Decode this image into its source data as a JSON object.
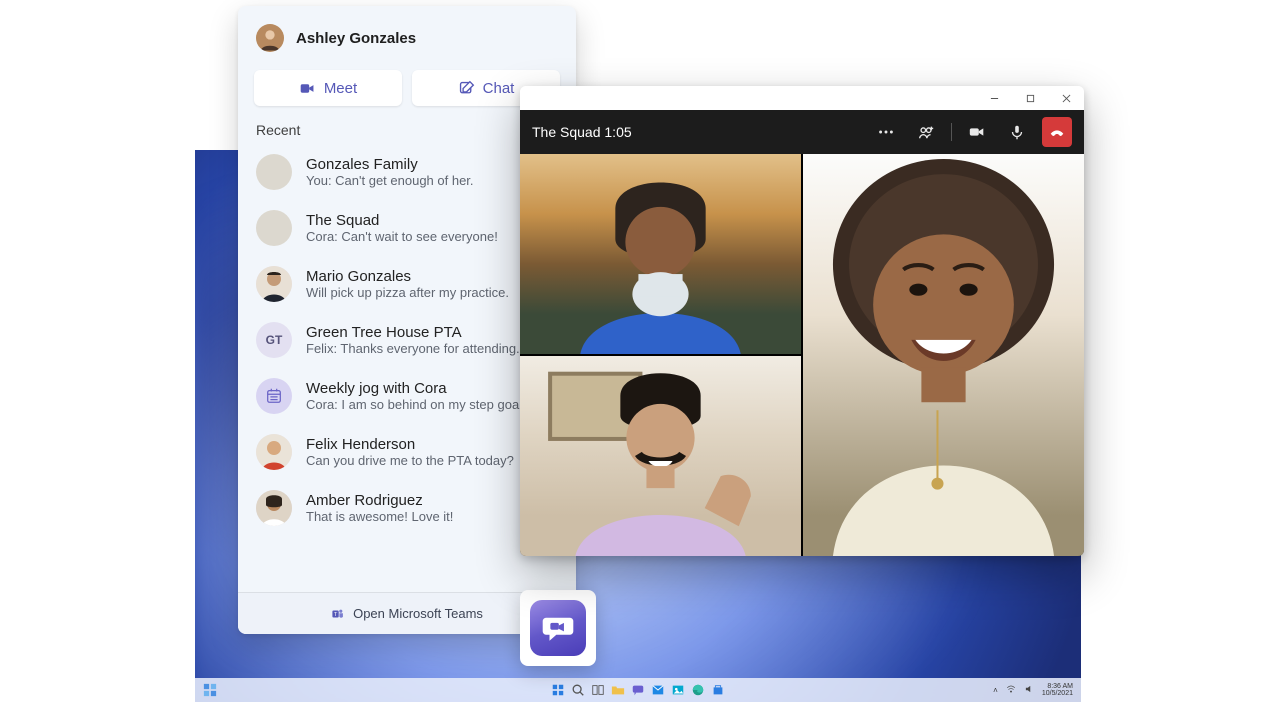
{
  "colors": {
    "accent": "#5558b7",
    "hangup": "#d53a3a"
  },
  "panel": {
    "user_name": "Ashley Gonzales",
    "actions": {
      "meet": "Meet",
      "chat": "Chat"
    },
    "section_label": "Recent",
    "footer": "Open Microsoft Teams",
    "chats": [
      {
        "title": "Gonzales Family",
        "preview": "You: Can't get enough of her.",
        "avatar": "grid"
      },
      {
        "title": "The Squad",
        "preview": "Cora: Can't wait to see everyone!",
        "avatar": "grid"
      },
      {
        "title": "Mario Gonzales",
        "preview": "Will pick up pizza after my practice.",
        "avatar": "person"
      },
      {
        "title": "Green Tree House PTA",
        "preview": "Felix: Thanks everyone for attending.",
        "avatar": "initials",
        "initials": "GT"
      },
      {
        "title": "Weekly jog with Cora",
        "preview": "Cora: I am so behind on my step goals.",
        "avatar": "calendar"
      },
      {
        "title": "Felix Henderson",
        "preview": "Can you drive me to the PTA today?",
        "avatar": "person"
      },
      {
        "title": "Amber Rodriguez",
        "preview": "That is awesome! Love it!",
        "avatar": "person"
      }
    ]
  },
  "call": {
    "title": "The Squad",
    "duration": "1:05"
  },
  "taskbar": {
    "time": "8:36 AM",
    "date": "10/5/2021"
  }
}
